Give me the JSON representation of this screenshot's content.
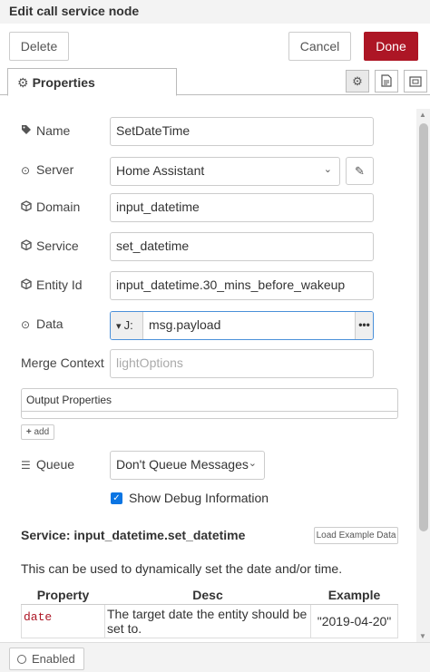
{
  "title": "Edit call service node",
  "actions": {
    "delete": "Delete",
    "cancel": "Cancel",
    "done": "Done"
  },
  "tabs": {
    "properties": "Properties"
  },
  "tab_tools": [
    "settings-icon",
    "description-icon",
    "appearance-icon"
  ],
  "fields": {
    "name": {
      "label": "Name",
      "value": "SetDateTime"
    },
    "server": {
      "label": "Server",
      "value": "Home Assistant"
    },
    "domain": {
      "label": "Domain",
      "value": "input_datetime"
    },
    "service": {
      "label": "Service",
      "value": "set_datetime"
    },
    "entity_id": {
      "label": "Entity Id",
      "value": "input_datetime.30_mins_before_wakeup"
    },
    "data": {
      "label": "Data",
      "type_glyph": "J:",
      "value": "msg.payload",
      "more": "•••"
    },
    "merge_context": {
      "label": "Merge Context",
      "placeholder": "lightOptions"
    },
    "output_properties": {
      "label": "Output Properties",
      "add_label": "add"
    },
    "queue": {
      "label": "Queue",
      "value": "Don't Queue Messages"
    },
    "debug": {
      "label": "Show Debug Information",
      "checked": true
    }
  },
  "service_info": {
    "title": "Service: input_datetime.set_datetime",
    "load_example": "Load Example Data",
    "description": "This can be used to dynamically set the date and/or time.",
    "table": {
      "headers": [
        "Property",
        "Desc",
        "Example"
      ],
      "rows": [
        {
          "property": "date",
          "desc": "The target date the entity should be set to.",
          "example": "\"2019-04-20\""
        }
      ]
    }
  },
  "footer": {
    "enabled": "Enabled"
  },
  "colors": {
    "done_button": "#ad1625",
    "checkbox": "#0b75e3",
    "focus_border": "#4a90d9"
  }
}
